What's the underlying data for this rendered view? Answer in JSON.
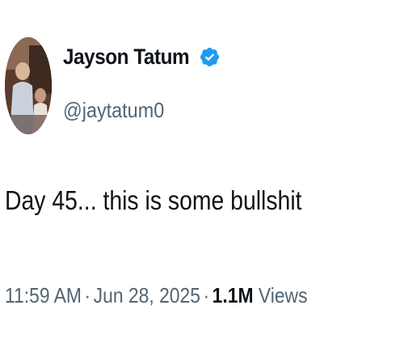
{
  "author": {
    "display_name": "Jayson Tatum",
    "handle": "@jaytatum0",
    "verified": true,
    "avatar_icon": "profile-photo"
  },
  "tweet": {
    "text": "Day 45... this is some bullshit"
  },
  "meta": {
    "time": "11:59 AM",
    "separator": "·",
    "date": "Jun 28, 2025",
    "views_count": "1.1M",
    "views_label": "Views"
  },
  "colors": {
    "primary_text": "#0f1419",
    "secondary_text": "#536471",
    "verified_blue": "#1d9bf0"
  }
}
